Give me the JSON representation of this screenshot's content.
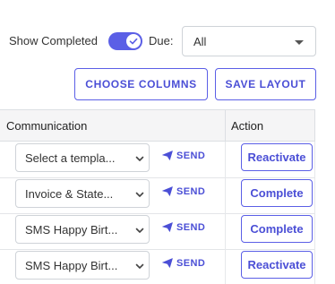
{
  "filters": {
    "show_completed_label": "Show Completed",
    "show_completed_on": true,
    "due_label": "Due:",
    "due_value": "All"
  },
  "toolbar": {
    "choose_columns": "CHOOSE COLUMNS",
    "save_layout": "SAVE LAYOUT"
  },
  "table": {
    "headers": {
      "communication": "Communication",
      "action": "Action"
    },
    "rows": [
      {
        "template": "Select a templa...",
        "send": "SEND",
        "action": "Reactivate"
      },
      {
        "template": "Invoice & State...",
        "send": "SEND",
        "action": "Complete"
      },
      {
        "template": "SMS Happy Birt...",
        "send": "SEND",
        "action": "Complete"
      },
      {
        "template": "SMS Happy Birt...",
        "send": "SEND",
        "action": "Reactivate"
      }
    ]
  },
  "colors": {
    "accent": "#5b5fe6",
    "accent_text": "#4b4fd6",
    "border": "#cfd3d8",
    "header_bg": "#f5f5f6"
  },
  "icons": {
    "send": "paper-plane-icon",
    "select": "chevron-down-icon",
    "toggle": "check-icon"
  }
}
